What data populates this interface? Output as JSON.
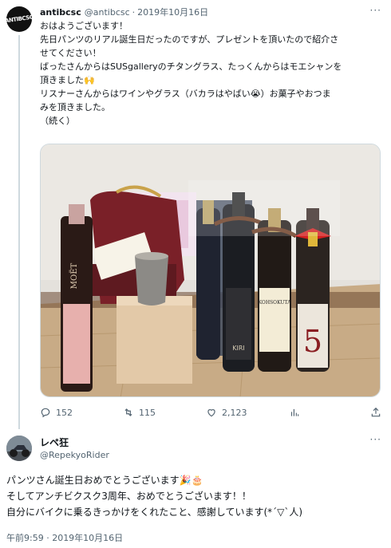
{
  "tweet1": {
    "avatar_text": "ANTIBCSC",
    "display_name": "antibcsc",
    "handle": "@antibcsc",
    "date": "2019年10月16日",
    "more": "···",
    "lines": [
      "おはようございます！",
      "先日パンツのリアル誕生日だったのですが、プレゼントを頂いたので紹介さ",
      "せてください！",
      "ばったさんからはSUSgalleryのチタングラス、たっくんからはモエシャンを",
      "頂きました🙌",
      "リスナーさんからはワインやグラス（バカラはやばい😭）お菓子やおつま",
      "みを頂きました。",
      "（続く）"
    ],
    "image_alt_bottles": [
      "MOËT",
      "KIRI",
      "KOHSOKUTA",
      "5"
    ],
    "actions": {
      "replies": "152",
      "retweets": "115",
      "likes": "2,123",
      "views": "",
      "share": ""
    }
  },
  "tweet2": {
    "display_name": "レペ狂",
    "handle": "@RepekyoRider",
    "more": "···",
    "lines": [
      "パンツさん誕生日おめでとうございます🎉🎂",
      "そしてアンチビクスク3周年、おめでとうございます！！",
      "自分にバイクに乗るきっかけをくれたこと、感謝しています(*´▽`人)"
    ],
    "timestamp": "午前9:59 · 2019年10月16日"
  },
  "colors": {
    "text": "#0f1419",
    "secondary": "#536471",
    "border": "#cfd9de"
  }
}
